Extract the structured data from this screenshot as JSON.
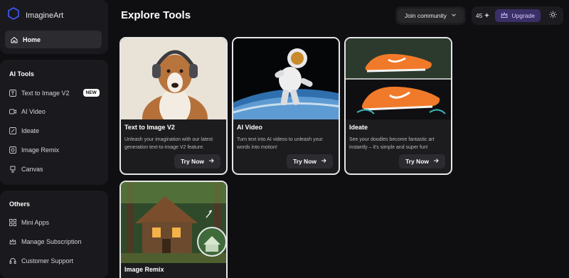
{
  "brand": {
    "name": "ImagineArt"
  },
  "sidebar": {
    "home_label": "Home",
    "ai_tools_title": "AI Tools",
    "ai_tools": [
      {
        "label": "Text to Image V2",
        "badge": "NEW",
        "icon": "text-icon"
      },
      {
        "label": "AI Video",
        "icon": "video-icon"
      },
      {
        "label": "Ideate",
        "icon": "pencil-icon"
      },
      {
        "label": "Image Remix",
        "icon": "remix-icon"
      },
      {
        "label": "Canvas",
        "icon": "canvas-icon"
      }
    ],
    "others_title": "Others",
    "others": [
      {
        "label": "Mini Apps",
        "icon": "grid-icon"
      },
      {
        "label": "Manage Subscription",
        "icon": "crown-icon"
      },
      {
        "label": "Customer Support",
        "icon": "headset-icon"
      }
    ]
  },
  "header": {
    "title": "Explore Tools",
    "join_label": "Join community",
    "credits": "45",
    "upgrade_label": "Upgrade"
  },
  "cards": [
    {
      "title": "Text to Image V2",
      "desc": "Unleash your imagination with our latest generation text-to-image V2 feature.",
      "button": "Try Now"
    },
    {
      "title": "AI Video",
      "desc": "Turn text into AI videos to unleash your words into motion!",
      "button": "Try Now"
    },
    {
      "title": "Ideate",
      "desc": "See your doodles become fantastic art instantly – it's simple and super fun!",
      "button": "Try Now"
    },
    {
      "title": "Image Remix",
      "desc": "",
      "button": ""
    }
  ],
  "colors": {
    "accent": "#3b2f68",
    "card_border": "#e6e6e8",
    "background": "#0f0f12"
  }
}
